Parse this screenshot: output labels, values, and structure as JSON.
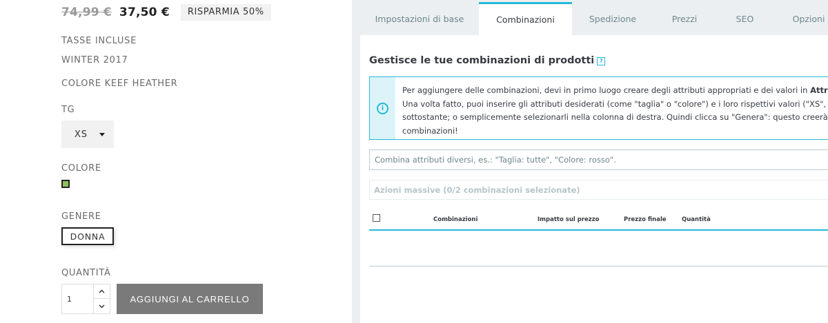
{
  "product": {
    "old_price": "74,99 €",
    "new_price": "37,50 €",
    "discount": "RISPARMIA 50%",
    "tax_note": "TASSE INCLUSE",
    "season": "WINTER 2017",
    "color_name": "COLORE KEEF HEATHER",
    "size_label": "TG",
    "size_value": "XS",
    "color_label": "COLORE",
    "color_swatch": "#8fc15b",
    "gender_label": "GENERE",
    "gender_value": "DONNA",
    "quantity_label": "QUANTITÀ",
    "quantity_value": "1",
    "add_to_cart": "AGGIUNGI AL CARRELLO"
  },
  "admin": {
    "tabs": [
      {
        "label": "Impostazioni di base",
        "active": false
      },
      {
        "label": "Combinazioni",
        "active": true
      },
      {
        "label": "Spedizione",
        "active": false
      },
      {
        "label": "Prezzi",
        "active": false
      },
      {
        "label": "SEO",
        "active": false
      },
      {
        "label": "Opzioni",
        "active": false
      }
    ],
    "section_title": "Gestisce le tue combinazioni di prodotti",
    "help_glyph": "?",
    "info_lines": {
      "line1_start": "Per aggiungere delle combinazioni, devi in primo luogo creare degli attributi appropriati e dei valori in ",
      "line1_bold": "Attributi e",
      "line2": "Una volta fatto, puoi inserire gli attributi desiderati (come \"taglia\" o \"colore\") e i loro rispettivi valori (\"XS\", \"rosso\", \"",
      "line3": "sottostante; o semplicemente selezionarli nella colonna di destra. Quindi clicca su \"Genera\": questo creerà automat",
      "line4": "combinazioni!"
    },
    "combo_placeholder": "Combina attributi diversi, es.: \"Taglia: tutte\", \"Colore: rosso\".",
    "bulk_actions": "Azioni massive (0/2 combinazioni selezionate)",
    "table_headers": [
      "Combinazioni",
      "Impatto sul prezzo",
      "Prezzo finale",
      "Quantità"
    ],
    "accent_color": "#25b9d7"
  }
}
